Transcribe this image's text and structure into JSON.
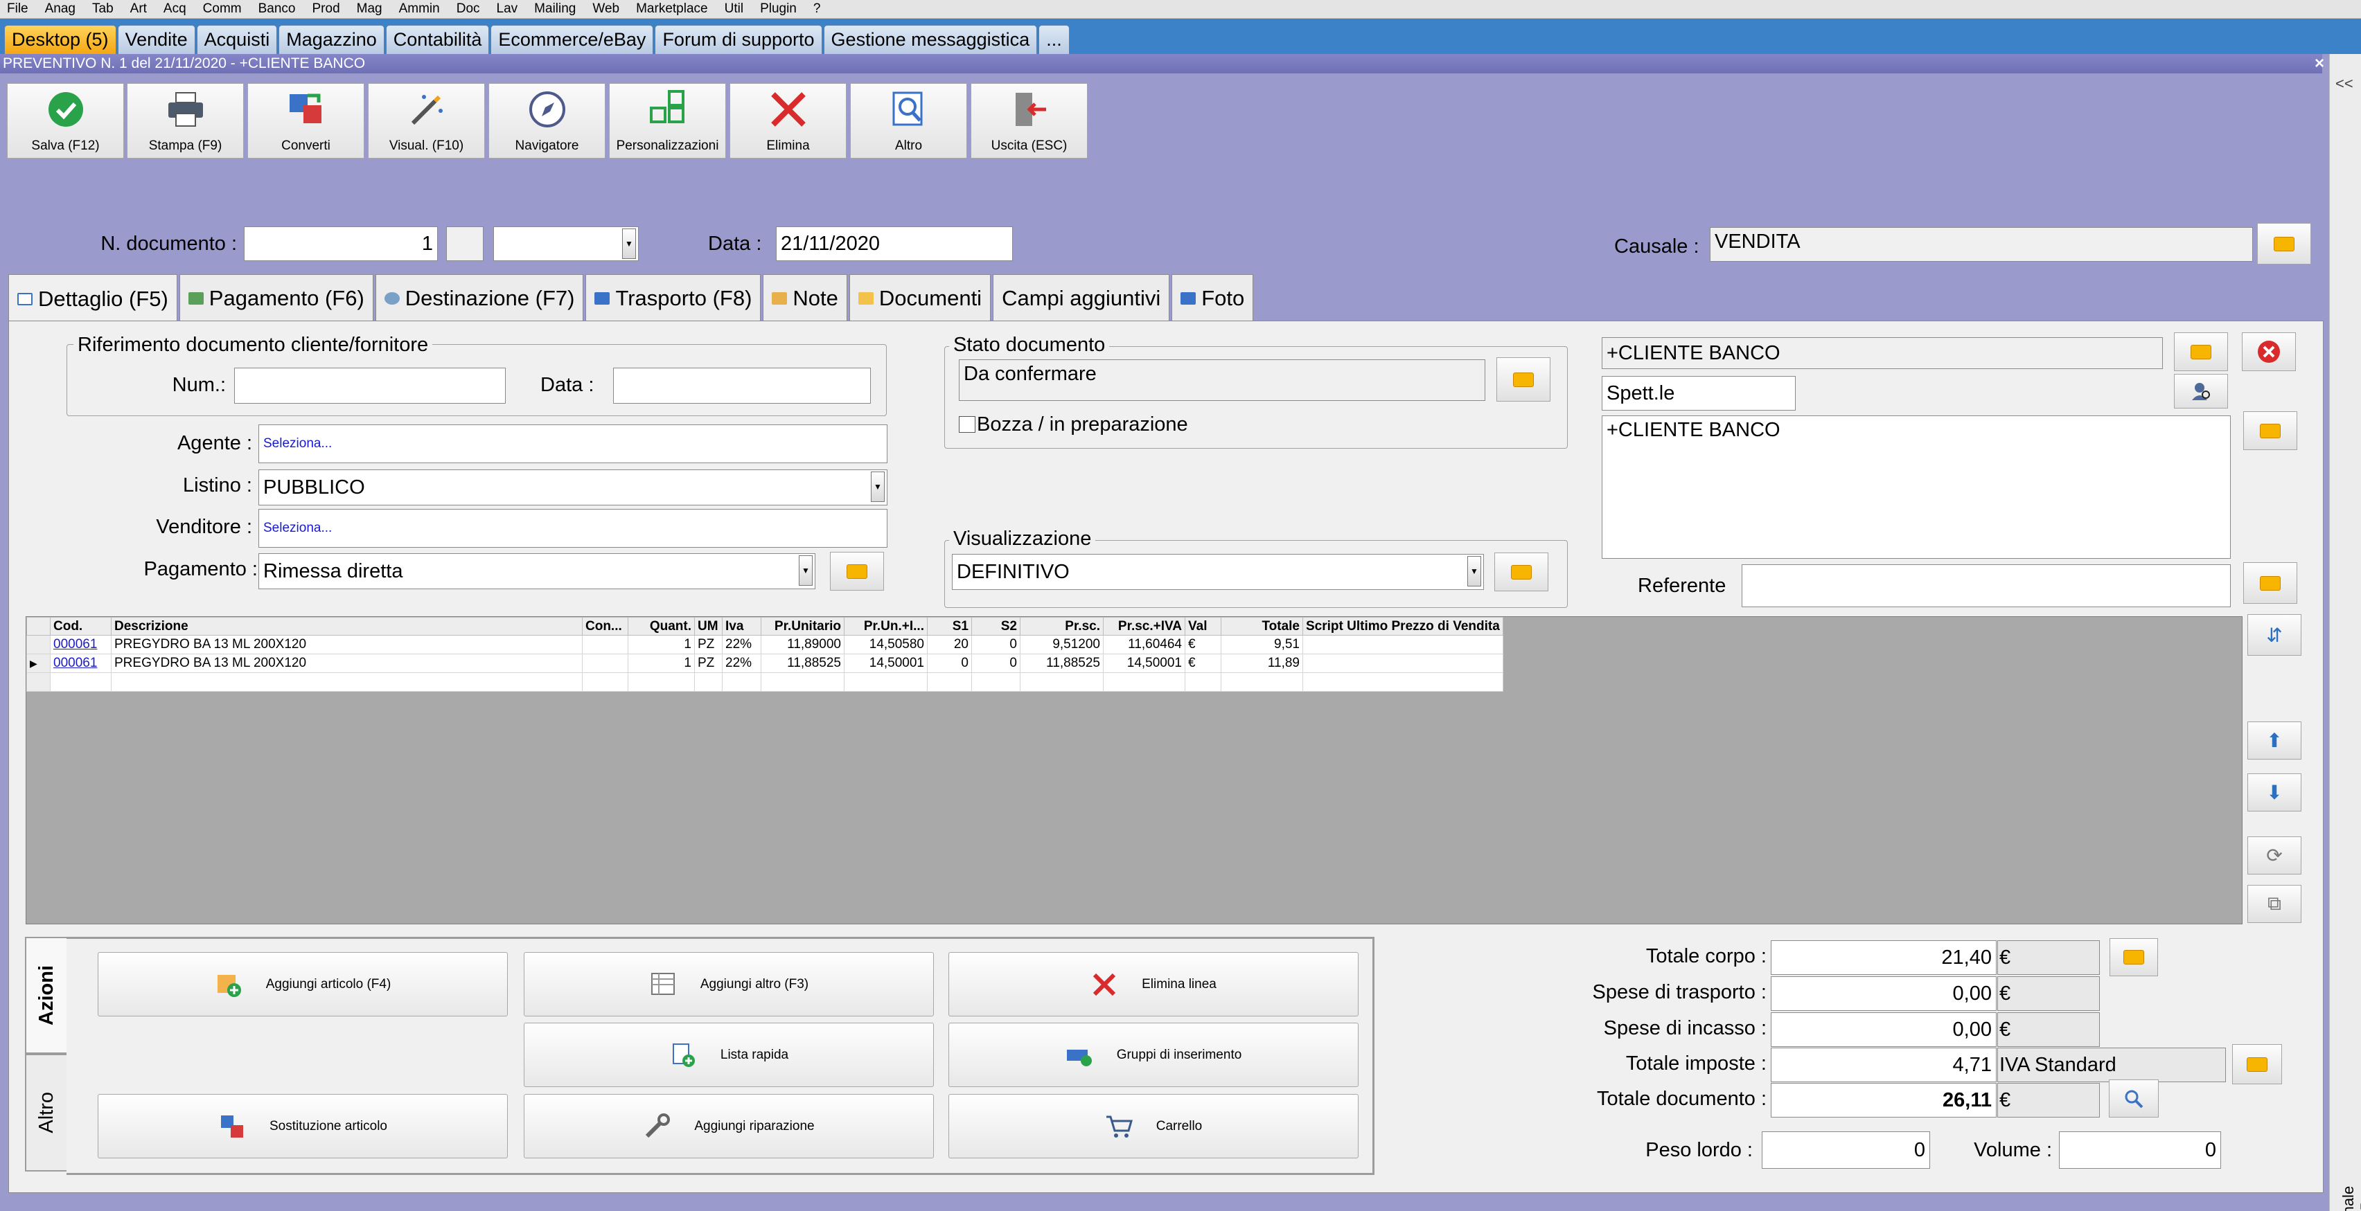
{
  "menu": [
    "File",
    "Anag",
    "Tab",
    "Art",
    "Acq",
    "Comm",
    "Banco",
    "Prod",
    "Mag",
    "Ammin",
    "Doc",
    "Lav",
    "Mailing",
    "Web",
    "Marketplace",
    "Util",
    "Plugin",
    "?"
  ],
  "desktop_tabs": [
    "Desktop (5)",
    "Vendite",
    "Acquisti",
    "Magazzino",
    "Contabilità",
    "Ecommerce/eBay",
    "Forum di supporto",
    "Gestione messaggistica",
    "..."
  ],
  "window": {
    "title": "PREVENTIVO N. 1 del 21/11/2020 - +CLIENTE BANCO",
    "close": "×"
  },
  "sidebar": {
    "chevron": "<<",
    "vertical_text": "Gestionale Ready Pro"
  },
  "toolbar": [
    {
      "label": "Salva (F12)",
      "icon": "check-circle-icon"
    },
    {
      "label": "Stampa (F9)",
      "icon": "printer-icon"
    },
    {
      "label": "Converti",
      "icon": "convert-icon"
    },
    {
      "label": "Visual. (F10)",
      "icon": "magic-wand-icon"
    },
    {
      "label": "Navigatore",
      "icon": "compass-icon"
    },
    {
      "label": "Personalizzazioni",
      "icon": "grid-blocks-icon"
    },
    {
      "label": "Elimina",
      "icon": "x-icon"
    },
    {
      "label": "Altro",
      "icon": "search-doc-icon"
    },
    {
      "label": "Uscita (ESC)",
      "icon": "exit-door-icon"
    }
  ],
  "header": {
    "ndoc_label": "N. documento :",
    "ndoc_value": "1",
    "data_label": "Data :",
    "data_value": "21/11/2020",
    "causale_label": "Causale :",
    "causale_value": "VENDITA"
  },
  "doc_tabs": [
    "Dettaglio (F5)",
    "Pagamento (F6)",
    "Destinazione (F7)",
    "Trasporto (F8)",
    "Note",
    "Documenti",
    "Campi aggiuntivi",
    "Foto"
  ],
  "riferimento": {
    "title": "Riferimento documento cliente/fornitore",
    "num_label": "Num.:",
    "num_value": "",
    "data_label": "Data :",
    "data_value": ""
  },
  "fields": {
    "agente_label": "Agente :",
    "agente_value": "Seleziona...",
    "listino_label": "Listino :",
    "listino_value": "PUBBLICO",
    "venditore_label": "Venditore :",
    "venditore_value": "Seleziona...",
    "pagamento_label": "Pagamento :",
    "pagamento_value": "Rimessa diretta"
  },
  "stato": {
    "title": "Stato documento",
    "value": "Da confermare",
    "bozza_label": "Bozza / in preparazione",
    "bozza_checked": false
  },
  "visualizzazione": {
    "title": "Visualizzazione",
    "value": "DEFINITIVO"
  },
  "cliente": {
    "name": "+CLIENTE BANCO",
    "spett": "Spett.le",
    "address": "+CLIENTE BANCO",
    "referente_label": "Referente",
    "referente_value": ""
  },
  "grid": {
    "columns": [
      "",
      "Cod.",
      "Descrizione",
      "Con...",
      "Quant.",
      "UM",
      "Iva",
      "Pr.Unitario",
      "Pr.Un.+I...",
      "S1",
      "S2",
      "Pr.sc.",
      "Pr.sc.+IVA",
      "Val",
      "Totale",
      "Script Ultimo Prezzo di Vendita"
    ],
    "rows": [
      [
        "",
        "000061",
        "PREGYDRO BA 13 ML 200X120",
        "",
        "1",
        "PZ",
        "22%",
        "11,89000",
        "14,50580",
        "20",
        "0",
        "9,51200",
        "11,60464",
        "€",
        "9,51",
        ""
      ],
      [
        "▶",
        "000061",
        "PREGYDRO BA 13 ML 200X120",
        "",
        "1",
        "PZ",
        "22%",
        "11,88525",
        "14,50001",
        "0",
        "0",
        "11,88525",
        "14,50001",
        "€",
        "11,89",
        ""
      ],
      [
        "",
        "",
        "",
        "",
        "",
        "",
        "",
        "",
        "",
        "",
        "",
        "",
        "",
        "",
        "",
        ""
      ]
    ]
  },
  "actions": {
    "tab_azioni": "Azioni",
    "tab_altro": "Altro",
    "buttons": [
      "Aggiungi articolo (F4)",
      "Aggiungi altro (F3)",
      "Elimina linea",
      "Lista rapida",
      "Gruppi di inserimento",
      "Sostituzione articolo",
      "Aggiungi riparazione",
      "Carrello"
    ]
  },
  "totals": {
    "corpo_label": "Totale corpo :",
    "corpo_value": "21,40",
    "trasporto_label": "Spese di trasporto :",
    "trasporto_value": "0,00",
    "incasso_label": "Spese di incasso :",
    "incasso_value": "0,00",
    "imposte_label": "Totale imposte :",
    "imposte_value": "4,71",
    "imposte_type": "IVA Standard",
    "documento_label": "Totale documento :",
    "documento_value": "26,11",
    "currency": "€",
    "peso_label": "Peso lordo :",
    "peso_value": "0",
    "volume_label": "Volume :",
    "volume_value": "0"
  },
  "colors": {
    "background": "#9a9acc",
    "tab_active": "#f4a614",
    "title_bar": "#6f6fb6",
    "link": "#1a1acc"
  }
}
